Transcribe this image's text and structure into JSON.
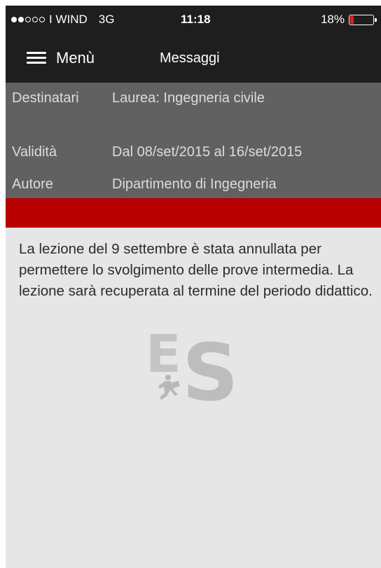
{
  "status_bar": {
    "signal_bars_filled": 2,
    "signal_bars_total": 5,
    "carrier": "I WIND",
    "network": "3G",
    "time": "11:18",
    "battery_text": "18%",
    "battery_level": 0.18,
    "battery_color": "#e81b1b"
  },
  "navbar": {
    "menu_label": "Menù",
    "title": "Messaggi"
  },
  "info": {
    "recipients_label": "Destinatari",
    "recipients_value": "Laurea: Ingegneria civile",
    "validity_label": "Validità",
    "validity_value": "Dal 08/set/2015 al 16/set/2015",
    "author_label": "Autore",
    "author_value": "Dipartimento di Ingegneria"
  },
  "accent_color": "#b80000",
  "message": {
    "body": "La lezione del 9 settembre è stata annullata per permettere lo svolgimento delle prove intermedia. La lezione sarà recuperata al termine del periodo didattico."
  },
  "watermark": {
    "icon": "es-logo-icon",
    "letters": "ES"
  }
}
